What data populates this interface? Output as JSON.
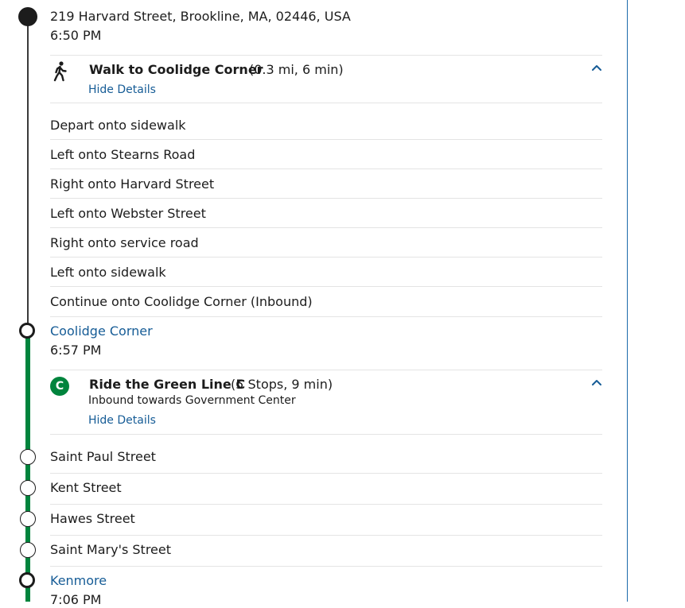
{
  "origin": {
    "address": "219 Harvard Street, Brookline, MA, 02446, USA",
    "time": "6:50 PM"
  },
  "walk_leg": {
    "title": "Walk to Coolidge Corner",
    "summary": "(0.3 mi, 6 min)",
    "toggle_label": "Hide Details",
    "steps": [
      "Depart onto sidewalk",
      "Left onto Stearns Road",
      "Right onto Harvard Street",
      "Left onto Webster Street",
      "Right onto service road",
      "Left onto sidewalk",
      "Continue onto Coolidge Corner (Inbound)"
    ]
  },
  "transfer_stop": {
    "name": "Coolidge Corner",
    "time": "6:57 PM"
  },
  "ride_leg": {
    "route_badge": "C",
    "title": "Ride the Green Line C",
    "summary": "(5 Stops, 9 min)",
    "direction": "Inbound towards Government Center",
    "toggle_label": "Hide Details",
    "intermediate_stops": [
      "Saint Paul Street",
      "Kent Street",
      "Hawes Street",
      "Saint Mary's Street"
    ],
    "line_color": "#00843d"
  },
  "destination_stop": {
    "name": "Kenmore",
    "time": "7:06 PM"
  },
  "colors": {
    "link": "#165c96",
    "divider": "#1c6bab",
    "green_line": "#00843d"
  },
  "icons": {
    "walk": "walking-person-icon",
    "collapse": "chevron-up-icon"
  }
}
